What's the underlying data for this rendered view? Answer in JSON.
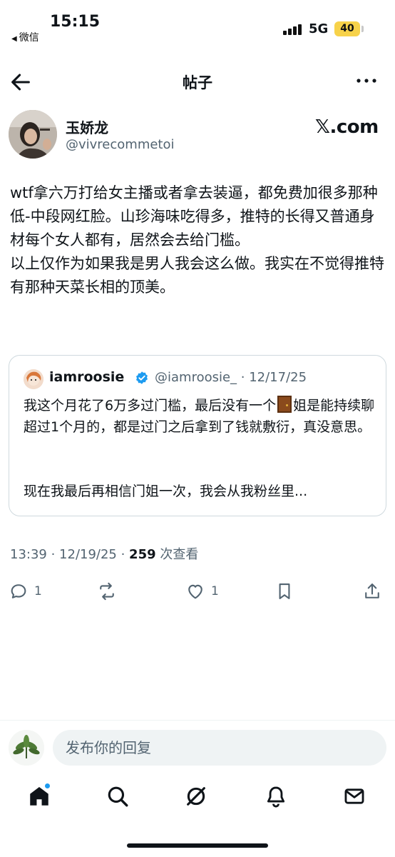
{
  "status_bar": {
    "time": "15:15",
    "back_app": "微信",
    "network": "5G",
    "battery": "40"
  },
  "nav": {
    "title": "帖子",
    "back_icon": "arrow-left-icon",
    "more_icon": "more-horizontal-icon"
  },
  "post": {
    "author_name": "玉娇龙",
    "author_handle": "@vivrecommetoi",
    "source": "𝕏.com",
    "text": "wtf拿六万打给女主播或者拿去装逼，都免费加很多那种低-中段网红脸。山珍海味吃得多，推特的长得又普通身材每个女人都有，居然会去给门槛。\n以上仅作为如果我是男人我会这么做。我实在不觉得推特有那种天菜长相的顶美。",
    "timestamp": "13:39 · 12/19/25 · ",
    "views_count": "259",
    "views_label": " 次查看"
  },
  "quote": {
    "name": "iamroosie",
    "handle_date": "@iamroosie_ · 12/17/25",
    "text_before_emoji": "我这个月花了6万多过门槛，最后没有一个",
    "text_after_emoji": "姐是能持续聊超过1个月的，都是过门之后拿到了钱就敷衍，真没意思。",
    "text_more": "现在我最后再相信门姐一次，我会从我粉丝里...",
    "verified_color": "#1d9bf0"
  },
  "actions": {
    "reply_count": "1",
    "like_count": "1"
  },
  "composer": {
    "placeholder": "发布你的回复"
  },
  "tabs": [
    "home-icon",
    "search-icon",
    "grok-icon",
    "notifications-icon",
    "messages-icon"
  ],
  "colors": {
    "text": "#0f1419",
    "secondary": "#536471",
    "accent": "#1d9bf0",
    "battery": "#f7d24a"
  }
}
